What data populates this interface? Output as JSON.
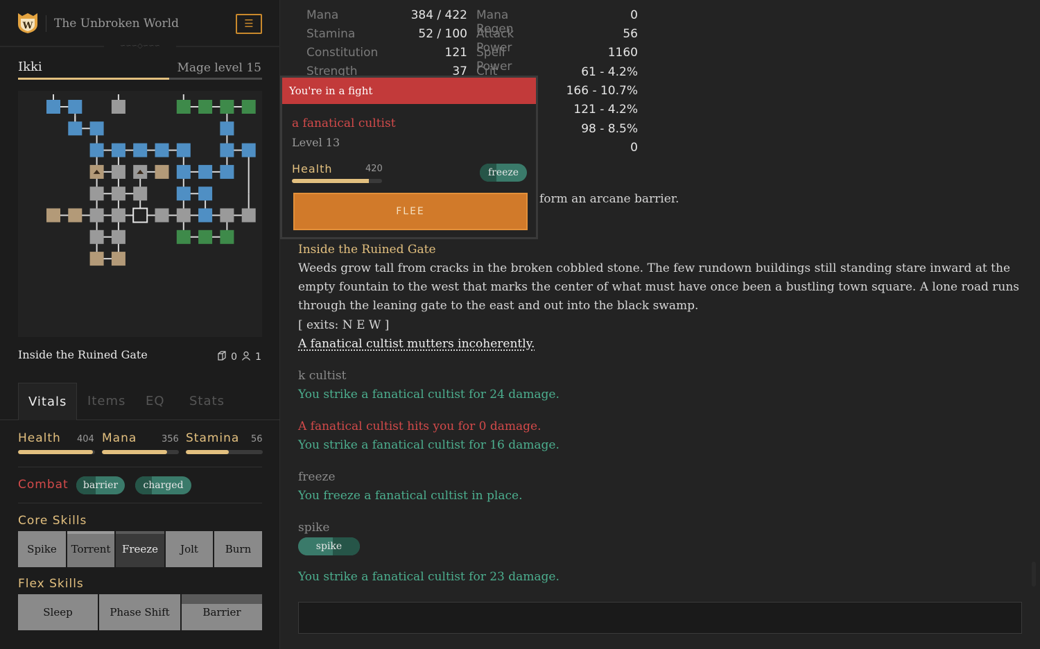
{
  "header": {
    "logo_letter": "W",
    "game_title": "The Unbroken World",
    "menu_icon": "☰"
  },
  "character": {
    "name": "Ikki",
    "class_level": "Mage level 15",
    "xp_progress": 0.62
  },
  "location": {
    "name": "Inside the Ruined Gate",
    "items_count": "0",
    "players_count": "1"
  },
  "tabs": [
    "Vitals",
    "Items",
    "EQ",
    "Stats"
  ],
  "vitals": {
    "health": {
      "label": "Health",
      "value": "404",
      "fill": 0.97
    },
    "mana": {
      "label": "Mana",
      "value": "356",
      "fill": 0.85
    },
    "stamina": {
      "label": "Stamina",
      "value": "56",
      "fill": 0.56
    }
  },
  "combat": {
    "label": "Combat",
    "effects": [
      "barrier",
      "charged"
    ]
  },
  "core_skills": {
    "label": "Core Skills",
    "items": [
      "Spike",
      "Torrent",
      "Freeze",
      "Jolt",
      "Burn"
    ]
  },
  "flex_skills": {
    "label": "Flex Skills",
    "items": [
      "Sleep",
      "Phase Shift",
      "Barrier"
    ]
  },
  "stats": {
    "left": [
      {
        "label": "Mana",
        "value": "384 / 422"
      },
      {
        "label": "Stamina",
        "value": "52 / 100"
      },
      {
        "label": "Constitution",
        "value": "121"
      },
      {
        "label": "Strength",
        "value": "37"
      }
    ],
    "right": [
      {
        "label": "Mana Regen",
        "value": "0"
      },
      {
        "label": "Attack Power",
        "value": "56"
      },
      {
        "label": "Spell Power",
        "value": "1160"
      },
      {
        "label": "Crit Chance",
        "value": "61 - 4.2%"
      },
      {
        "label": "",
        "value": "166 - 10.7%"
      },
      {
        "label": "",
        "value": "121 - 4.2%"
      },
      {
        "label": "",
        "value": "98 - 8.5%"
      },
      {
        "label": "",
        "value": "0"
      }
    ]
  },
  "fight": {
    "title": "You're in a fight",
    "enemy_name": "a fanatical cultist",
    "enemy_level": "Level 13",
    "health_label": "Health",
    "health_value": "420",
    "health_fill": 0.85,
    "effect": "freeze",
    "flee_label": "FLEE"
  },
  "log": {
    "barrier_tail": "form an arcane barrier.",
    "room_title": "Inside the Ruined Gate",
    "room_desc": [
      "Weeds grow tall from cracks in the broken cobbled stone. The few rundown buildings still standing stare inward at the",
      "empty fountain to the west that marks the center of what must have once been a bustling town square. A lone road runs",
      "through the leaning gate to the east and out into the black swamp."
    ],
    "exits": "[ exits: N E W ]",
    "npc_line": "A fanatical cultist mutters incoherently.",
    "cmd1": "k cultist",
    "msg1": "You strike a fanatical cultist for 24 damage.",
    "msg2": "A fanatical cultist hits you for 0 damage.",
    "msg3": "You strike a fanatical cultist for 16 damage.",
    "cmd2": "freeze",
    "msg4": "You freeze a fanatical cultist in place.",
    "cmd3": "spike",
    "spike_pill": "spike",
    "msg5": "You strike a fanatical cultist for 23 damage."
  },
  "colors": {
    "gold": "#e3c07f",
    "red": "#d34a4a",
    "teal": "#4caf8f",
    "orange": "#d17a2a",
    "map_blue": "#4f8fc4",
    "map_green": "#3e8a4a",
    "map_grey": "#9a9a9a",
    "map_tan": "#b39a78"
  }
}
